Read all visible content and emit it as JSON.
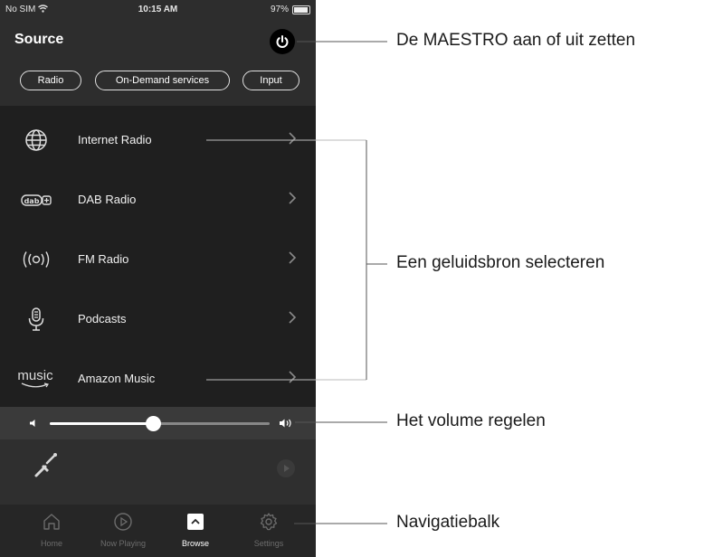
{
  "status_bar": {
    "carrier": "No SIM",
    "time": "10:15 AM",
    "battery": "97%"
  },
  "header": {
    "title": "Source"
  },
  "tabs": [
    {
      "label": "Radio"
    },
    {
      "label": "On-Demand services"
    },
    {
      "label": "Input"
    }
  ],
  "sources": [
    {
      "label": "Internet Radio",
      "icon": "globe-icon"
    },
    {
      "label": "DAB Radio",
      "icon": "dab-icon"
    },
    {
      "label": "FM Radio",
      "icon": "fm-icon"
    },
    {
      "label": "Podcasts",
      "icon": "microphone-icon"
    },
    {
      "label": "Amazon Music",
      "icon": "amazon-music-icon",
      "icon_text": "music"
    }
  ],
  "volume": {
    "level": 0.47
  },
  "nav": [
    {
      "label": "Home",
      "icon": "home-icon",
      "active": false
    },
    {
      "label": "Now Playing",
      "icon": "play-circle-icon",
      "active": false
    },
    {
      "label": "Browse",
      "icon": "browse-icon",
      "active": true
    },
    {
      "label": "Settings",
      "icon": "gear-icon",
      "active": false
    }
  ],
  "callouts": {
    "power": "De MAESTRO aan of uit zetten",
    "source": "Een geluidsbron selecteren",
    "volume": "Het volume regelen",
    "navigation": "Navigatiebalk"
  },
  "colors": {
    "background": "#2d2d2d",
    "list_background": "#1f1f1f",
    "accent": "#ffffff"
  }
}
